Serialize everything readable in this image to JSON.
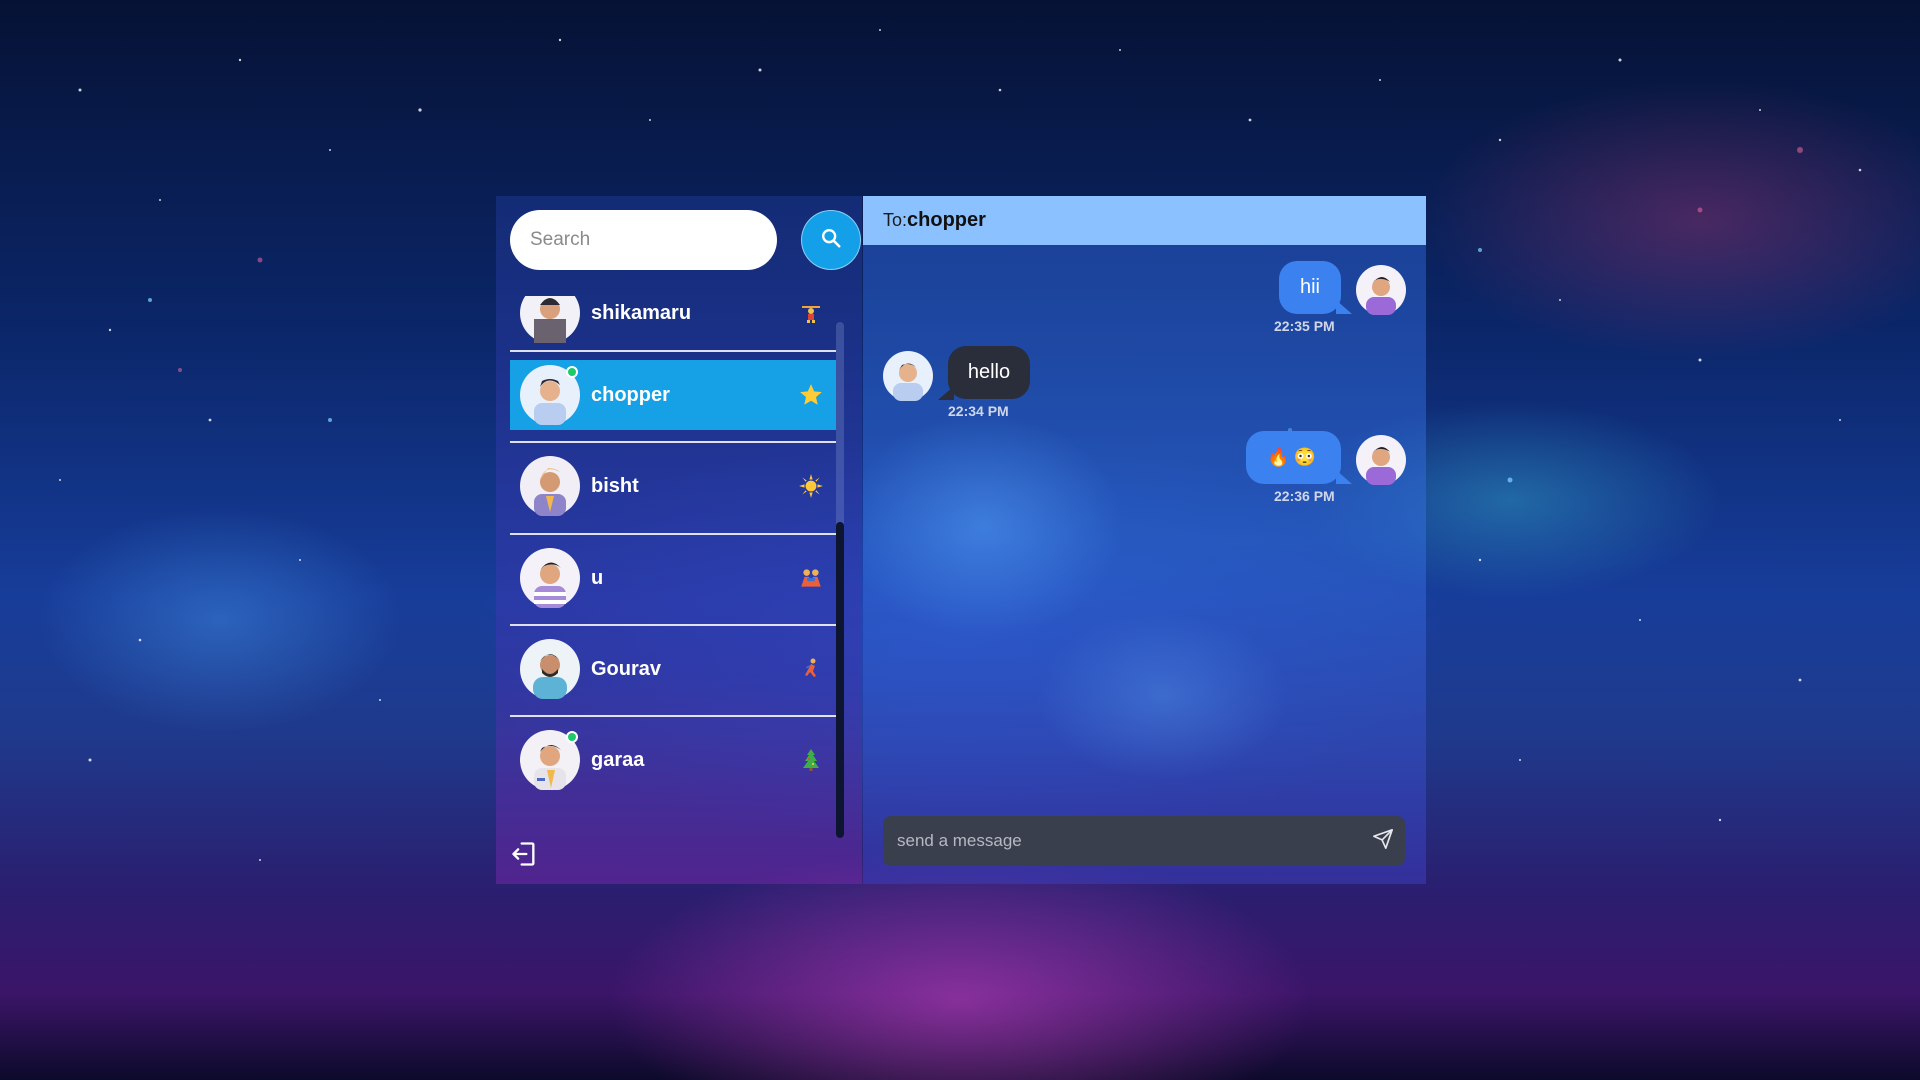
{
  "search": {
    "placeholder": "Search",
    "button_icon": "search-icon"
  },
  "contacts": [
    {
      "name": "shikamaru",
      "status_icon": "weightlifter-emoji",
      "online": false,
      "active": false
    },
    {
      "name": "chopper",
      "status_icon": "star-emoji",
      "online": true,
      "active": true
    },
    {
      "name": "bisht",
      "status_icon": "sun-emoji",
      "online": false,
      "active": false
    },
    {
      "name": "u",
      "status_icon": "people-hugging-emoji",
      "online": false,
      "active": false
    },
    {
      "name": "Gourav",
      "status_icon": "runner-emoji",
      "online": false,
      "active": false
    },
    {
      "name": "garaa",
      "status_icon": "christmas-tree-emoji",
      "online": true,
      "active": false
    }
  ],
  "logout_icon": "logout-icon",
  "chat": {
    "to_label": "To:",
    "to_name": "chopper",
    "messages": [
      {
        "direction": "out",
        "text": "hii",
        "time": "22:35 PM"
      },
      {
        "direction": "in",
        "text": "hello",
        "time": "22:34 PM"
      },
      {
        "direction": "out",
        "text": "🔥😳",
        "time": "22:36 PM"
      }
    ],
    "composer_placeholder": "send a message",
    "send_icon": "send-icon"
  },
  "colors": {
    "active_contact": "#16a0e6",
    "search_button": "#14a0e8",
    "header": "#8cc1ff",
    "outgoing_bubble": "#3b82f0",
    "incoming_bubble": "#2a2d3a",
    "online_dot": "#1ec96b"
  }
}
